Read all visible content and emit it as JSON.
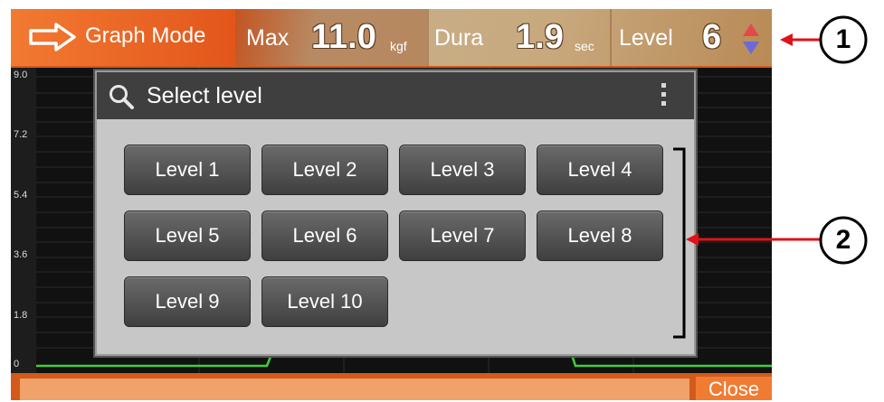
{
  "topbar": {
    "mode_label": "Graph Mode",
    "max_label": "Max",
    "max_value": "11.0",
    "max_unit": "kgf",
    "dura_label": "Dura",
    "dura_value": "1.9",
    "dura_unit": "sec",
    "level_label": "Level",
    "level_value": "6"
  },
  "chart": {
    "y_ticks": [
      "9.0",
      "7.2",
      "5.4",
      "3.6",
      "1.8",
      "0"
    ],
    "line_color": "#3ecf3e"
  },
  "dialog": {
    "title": "Select level",
    "levels": [
      "Level 1",
      "Level 2",
      "Level 3",
      "Level 4",
      "Level 5",
      "Level 6",
      "Level 7",
      "Level 8",
      "Level 9",
      "Level 10"
    ]
  },
  "bottom": {
    "close_label": "Close"
  },
  "annotations": {
    "callout_1": "1",
    "callout_2": "2",
    "arrow_color": "#e0121a"
  }
}
